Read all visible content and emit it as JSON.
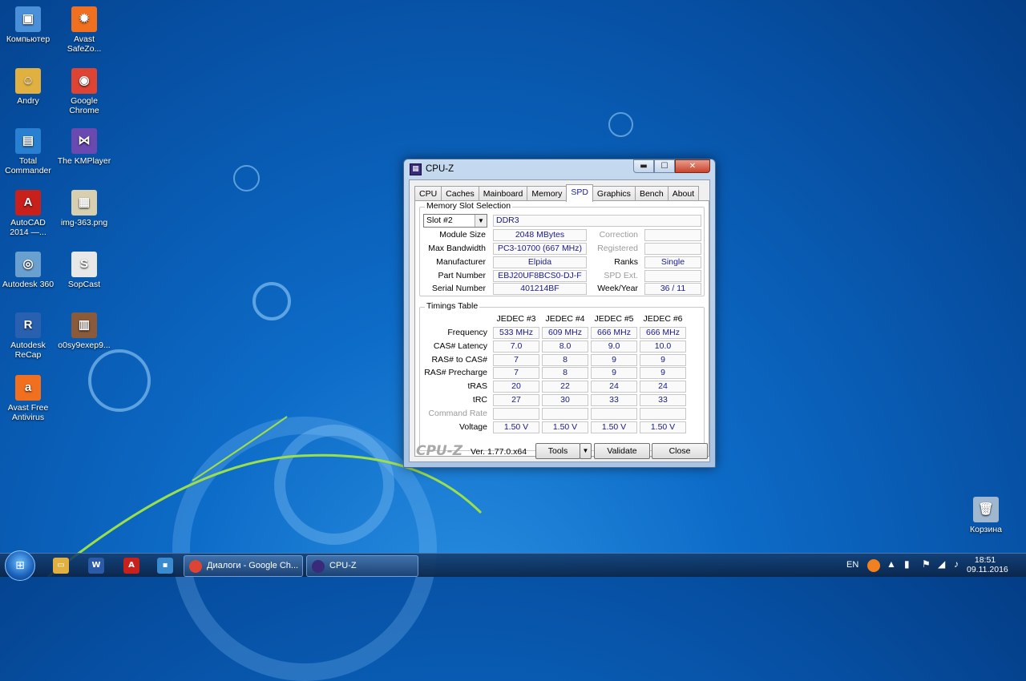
{
  "desktop": {
    "icons": [
      {
        "label": "Компьютер",
        "glyph": "▣",
        "color": "#4a90d9"
      },
      {
        "label": "Avast SafeZo...",
        "glyph": "✹",
        "color": "#f07020"
      },
      {
        "label": "Andry",
        "glyph": "☺",
        "color": "#e0b040"
      },
      {
        "label": "Google Chrome",
        "glyph": "◉",
        "color": "#dd4433"
      },
      {
        "label": "Total Commander",
        "glyph": "▤",
        "color": "#2a80d0"
      },
      {
        "label": "The KMPlayer",
        "glyph": "⋈",
        "color": "#6a4ab0"
      },
      {
        "label": "AutoCAD 2014 —...",
        "glyph": "A",
        "color": "#c8201a"
      },
      {
        "label": "img-363.png",
        "glyph": "▦",
        "color": "#d8cfb0"
      },
      {
        "label": "Autodesk 360",
        "glyph": "◎",
        "color": "#6aa0d0"
      },
      {
        "label": "SopCast",
        "glyph": "S",
        "color": "#e8e8e8"
      },
      {
        "label": "Autodesk ReCap",
        "glyph": "R",
        "color": "#2a60b0"
      },
      {
        "label": "o0sy9exep9...",
        "glyph": "▥",
        "color": "#8a5a3a"
      },
      {
        "label": "Avast Free Antivirus",
        "glyph": "a",
        "color": "#f07020"
      },
      {
        "label": "Корзина",
        "glyph": "🗑",
        "color": "#9fb8d0"
      }
    ]
  },
  "window": {
    "title": "CPU-Z",
    "icon": "cpu-z-icon",
    "controls": {
      "minimize": "▬",
      "maximize": "☐",
      "close": "✕"
    },
    "tabs": [
      "CPU",
      "Caches",
      "Mainboard",
      "Memory",
      "SPD",
      "Graphics",
      "Bench",
      "About"
    ],
    "active_tab": "SPD",
    "slot": {
      "group_label": "Memory Slot Selection",
      "selected": "Slot #2",
      "type": "DDR3",
      "module_size_label": "Module Size",
      "module_size": "2048 MBytes",
      "max_bandwidth_label": "Max Bandwidth",
      "max_bandwidth": "PC3-10700 (667 MHz)",
      "manufacturer_label": "Manufacturer",
      "manufacturer": "Elpida",
      "part_number_label": "Part Number",
      "part_number": "EBJ20UF8BCS0-DJ-F",
      "serial_number_label": "Serial Number",
      "serial_number": "401214BF",
      "correction_label": "Correction",
      "correction": "",
      "registered_label": "Registered",
      "registered": "",
      "ranks_label": "Ranks",
      "ranks": "Single",
      "spd_ext_label": "SPD Ext.",
      "spd_ext": "",
      "week_year_label": "Week/Year",
      "week_year": "36 / 11"
    },
    "timings": {
      "group_label": "Timings Table",
      "columns": [
        "JEDEC #3",
        "JEDEC #4",
        "JEDEC #5",
        "JEDEC #6"
      ],
      "rows": [
        {
          "label": "Frequency",
          "dim": false,
          "values": [
            "533 MHz",
            "609 MHz",
            "666 MHz",
            "666 MHz"
          ]
        },
        {
          "label": "CAS# Latency",
          "dim": false,
          "values": [
            "7.0",
            "8.0",
            "9.0",
            "10.0"
          ]
        },
        {
          "label": "RAS# to CAS#",
          "dim": false,
          "values": [
            "7",
            "8",
            "9",
            "9"
          ]
        },
        {
          "label": "RAS# Precharge",
          "dim": false,
          "values": [
            "7",
            "8",
            "9",
            "9"
          ]
        },
        {
          "label": "tRAS",
          "dim": false,
          "values": [
            "20",
            "22",
            "24",
            "24"
          ]
        },
        {
          "label": "tRC",
          "dim": false,
          "values": [
            "27",
            "30",
            "33",
            "33"
          ]
        },
        {
          "label": "Command Rate",
          "dim": true,
          "values": [
            "",
            "",
            "",
            ""
          ]
        },
        {
          "label": "Voltage",
          "dim": false,
          "values": [
            "1.50 V",
            "1.50 V",
            "1.50 V",
            "1.50 V"
          ]
        }
      ]
    },
    "footer": {
      "brand": "CPU-Z",
      "version": "Ver. 1.77.0.x64",
      "tools": "Tools",
      "validate": "Validate",
      "close": "Close"
    }
  },
  "taskbar": {
    "start_glyph": "⊞",
    "pinned": [
      {
        "name": "explorer-icon",
        "glyph": "▭",
        "color": "#e0b040"
      },
      {
        "name": "word-icon",
        "glyph": "W",
        "color": "#2a5aa8"
      },
      {
        "name": "autocad-icon",
        "glyph": "A",
        "color": "#c8201a"
      },
      {
        "name": "app-icon",
        "glyph": "▪",
        "color": "#3a8ad0"
      }
    ],
    "tasks": [
      {
        "label": "Диалоги - Google Ch...",
        "color": "#dd4433"
      },
      {
        "label": "CPU-Z",
        "color": "#3a2a7a"
      }
    ],
    "language": "EN",
    "time": "18:51",
    "date": "09.11.2016"
  }
}
